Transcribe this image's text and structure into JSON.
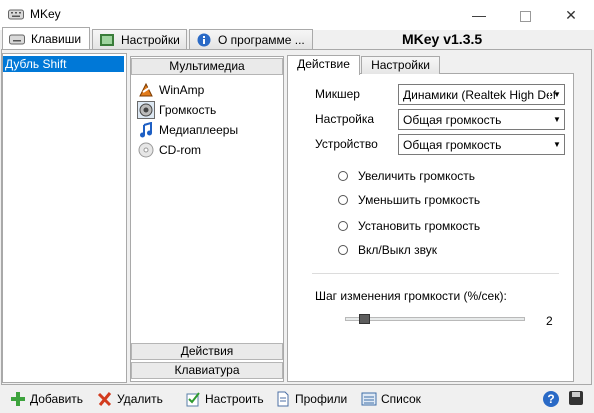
{
  "window": {
    "title": "MKey"
  },
  "main_tabs": [
    {
      "label": "Клавиши"
    },
    {
      "label": "Настройки"
    },
    {
      "label": "О программе ..."
    }
  ],
  "app_version": "MKey v1.3.5",
  "keys_list": {
    "items": [
      "Дубль Shift"
    ]
  },
  "categories": {
    "top": "Мультимедиа",
    "items": [
      "WinAmp",
      "Громкость",
      "Медиаплееры",
      "CD-rom"
    ],
    "bottom": [
      "Действия",
      "Клавиатура"
    ]
  },
  "right_tabs": [
    "Действие",
    "Настройки"
  ],
  "form": {
    "mixer_label": "Микшер",
    "mixer_value": "Динамики (Realtek High Def",
    "setting_label": "Настройка",
    "setting_value": "Общая громкость",
    "device_label": "Устройство",
    "device_value": "Общая громкость"
  },
  "radios": [
    "Увеличить громкость",
    "Уменьшить громкость",
    "Установить громкость",
    "Вкл/Выкл звук"
  ],
  "step": {
    "label": "Шаг изменения громкости (%/сек):",
    "value": "2"
  },
  "toolbar": {
    "add": "Добавить",
    "delete": "Удалить",
    "configure": "Настроить",
    "profiles": "Профили",
    "list": "Список",
    "help": "?"
  }
}
